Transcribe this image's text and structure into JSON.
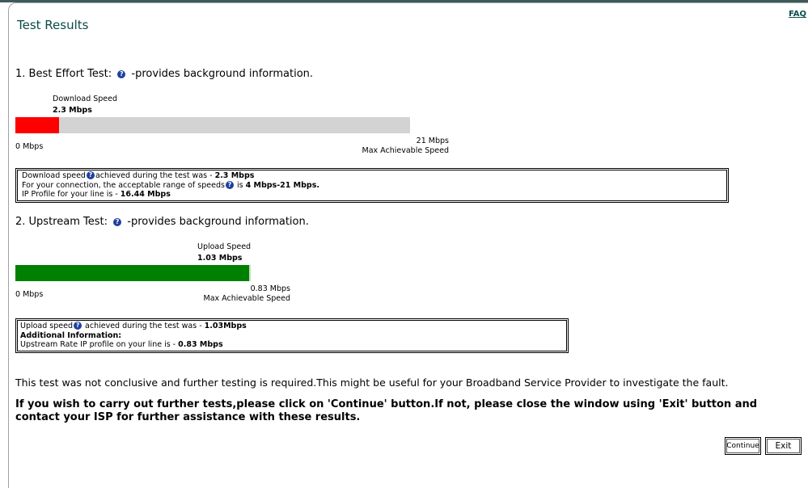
{
  "header": {
    "faq_label": "FAQ",
    "title": "Test Results"
  },
  "best_effort": {
    "heading": "1. Best Effort Test:",
    "heading_suffix": "-provides background information.",
    "gauge_title": "Download  Speed",
    "gauge_value": "2.3 Mbps",
    "min_label": "0 Mbps",
    "max_label": "21 Mbps",
    "max_caption": "Max Achievable Speed",
    "fill_fraction": 0.11,
    "fill_color": "#ff0000",
    "track_color": "#d3d3d3",
    "info": {
      "line1_a": "Download speed",
      "line1_b": "achieved during the test was - ",
      "line1_value": "2.3 Mbps",
      "line2_a": "For your connection, the acceptable range of speeds",
      "line2_b": " is ",
      "line2_value": "4 Mbps-21 Mbps",
      "line2_end": ".",
      "line3_a": "IP Profile for your line is - ",
      "line3_value": "16.44 Mbps"
    }
  },
  "upstream": {
    "heading": "2. Upstream Test:",
    "heading_suffix": "-provides background information.",
    "gauge_title": "Upload Speed",
    "gauge_value": "1.03 Mbps",
    "min_label": "0 Mbps",
    "max_label": "0.83 Mbps",
    "max_caption": "Max Achievable Speed",
    "fill_fraction": 1.0,
    "fill_color": "#008000",
    "info": {
      "line1_a": "Upload speed",
      "line1_b": " achieved during the test was - ",
      "line1_value": "1.03Mbps",
      "line2": "Additional Information:",
      "line3_a": "Upstream Rate IP profile on your line is - ",
      "line3_value": "0.83 Mbps"
    }
  },
  "messages": {
    "inconclusive": "This test was not conclusive and further testing is required.This might be useful for your Broadband Service Provider to investigate the fault.",
    "instructions": "If you wish to carry out further tests,please click on 'Continue' button.If not, please close the window using 'Exit' button and contact your ISP for further assistance with these results."
  },
  "buttons": {
    "continue_label": "Continue",
    "exit_label": "Exit"
  }
}
